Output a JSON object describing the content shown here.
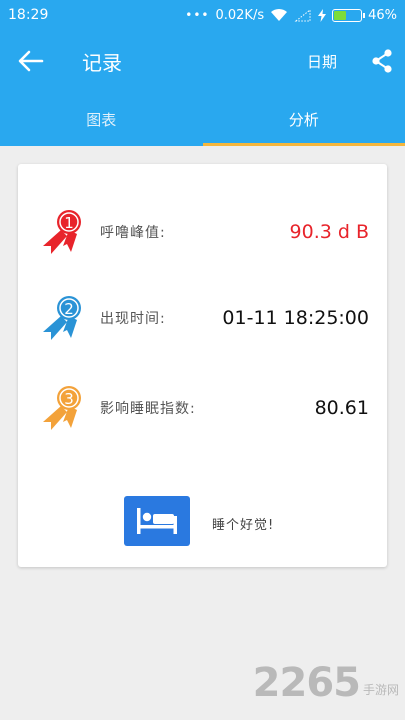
{
  "status": {
    "time": "18:29",
    "network_speed": "0.02K/s",
    "battery": "46%",
    "battery_level": 0.46
  },
  "header": {
    "title": "记录",
    "date_label": "日期"
  },
  "tabs": [
    {
      "label": "图表"
    },
    {
      "label": "分析"
    }
  ],
  "tabs_active_index": 1,
  "records": [
    {
      "rank": "1",
      "label": "呼噜峰值:",
      "value": "90.3 d B",
      "color": "#e8242b"
    },
    {
      "rank": "2",
      "label": "出现时间:",
      "value": "01-11 18:25:00",
      "color": "#2a93d6"
    },
    {
      "rank": "3",
      "label": "影响睡眠指数:",
      "value": "80.61",
      "color": "#f3a23a"
    }
  ],
  "sleep": {
    "label": "睡个好觉!"
  },
  "watermark": {
    "number": "2265",
    "text": "手游网"
  },
  "icons": {
    "back": "arrow-left-icon",
    "share": "share-icon",
    "bed": "bed-icon",
    "wifi": "wifi-icon",
    "charging": "bolt-icon"
  }
}
